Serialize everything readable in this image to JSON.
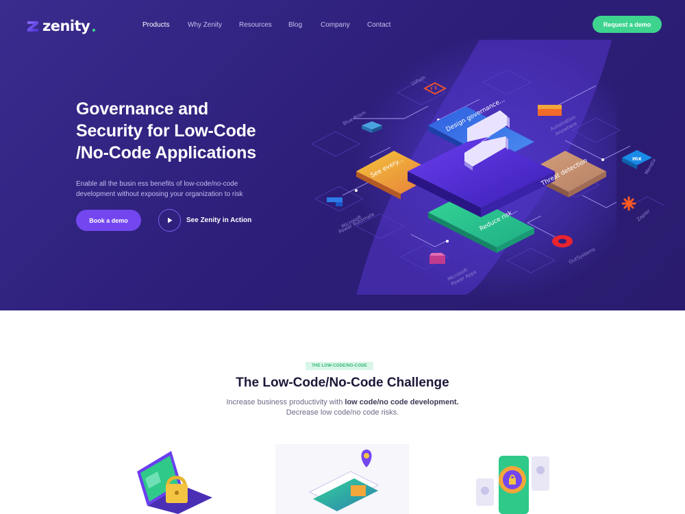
{
  "brand": {
    "name": "zenity"
  },
  "nav": {
    "items": [
      {
        "label": "Products",
        "active": true
      },
      {
        "label": "Why Zenity",
        "active": false
      },
      {
        "label": "Resources",
        "active": false
      },
      {
        "label": "Blog",
        "active": false
      },
      {
        "label": "Company",
        "active": false
      },
      {
        "label": "Contact",
        "active": false
      }
    ],
    "cta": "Request a demo"
  },
  "hero": {
    "title_lines": [
      "Governance and",
      "Security for Low-Code",
      "/No-Code Applications"
    ],
    "subtitle_lines": [
      "Enable all the busin ess benefits of low-code/no-code",
      "development without exposing your organization to risk"
    ],
    "primary_button": "Book a demo",
    "secondary_button": "See Zenity in Action",
    "diagram": {
      "center_tiles": [
        "Design governance...",
        "Threat detection",
        "Reduce risk...",
        "See every..."
      ],
      "platforms": [
        "UiPath",
        "Blue Prism",
        "Automation Anywhere",
        "Mendix",
        "Zapier",
        "OutSystems",
        "Microsoft Power Apps",
        "Microsoft Power Automate"
      ]
    }
  },
  "challenge": {
    "tag": "THE LOW-CODE/NO-CODE",
    "title": "The Low-Code/No-Code Challenge",
    "subtitle_prefix": "Increase business productivity with ",
    "subtitle_bold": "low code/no code development.",
    "subtitle_line2": "Decrease low code/no code risks."
  },
  "colors": {
    "hero_bg": "#2d1f7a",
    "accent_green": "#3ed48f",
    "accent_purple": "#7346f0",
    "tile_blue": "#3b6fe0",
    "tile_orange": "#f0b13a",
    "tile_green": "#2fc98a",
    "tile_tan": "#c99273"
  },
  "icons": [
    "logo-mark-icon",
    "play-icon",
    "uipath-icon",
    "blueprism-icon",
    "automation-anywhere-icon",
    "mendix-icon",
    "zapier-icon",
    "outsystems-icon",
    "power-apps-icon",
    "power-automate-icon",
    "lock-laptop-icon",
    "phone-pin-icon",
    "magnifier-lock-icon"
  ]
}
